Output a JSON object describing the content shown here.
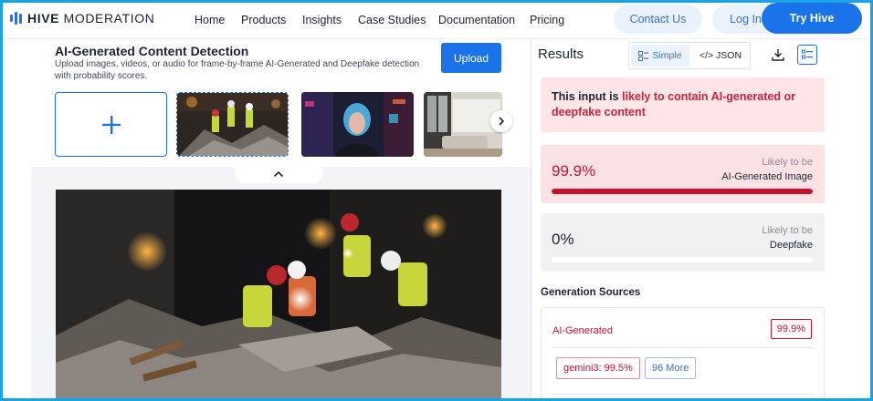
{
  "nav": {
    "logo_bold": "HIVE",
    "logo_rest": " MODERATION",
    "links": [
      "Home",
      "Products",
      "Insights",
      "Case Studies",
      "Documentation",
      "Pricing"
    ],
    "contact": "Contact Us",
    "login": "Log In",
    "try": "Try Hive"
  },
  "detector": {
    "title": "AI-Generated Content Detection",
    "description": "Upload images, videos, or audio for frame-by-frame AI-Generated and Deepfake detection with probability scores.",
    "upload": "Upload"
  },
  "results": {
    "title": "Results",
    "toggle_simple": "Simple",
    "toggle_json": "</> JSON",
    "verdict_prefix": "This input is ",
    "verdict_highlight": "likely to contain AI-generated or deepfake content",
    "scores": [
      {
        "value": "99.9%",
        "likely": "Likely to be",
        "kind": "AI-Generated Image",
        "fraction": 0.999
      },
      {
        "value": "0%",
        "likely": "Likely to be",
        "kind": "Deepfake",
        "fraction": 0.0
      }
    ],
    "generation": {
      "title": "Generation Sources",
      "label": "AI-Generated",
      "pct": "99.9%",
      "top_source": "gemini3: 99.5%",
      "more": "96 More"
    }
  },
  "colors": {
    "accent": "#1a73e8",
    "danger": "#c8102e",
    "danger_bg": "#fde2e5"
  }
}
